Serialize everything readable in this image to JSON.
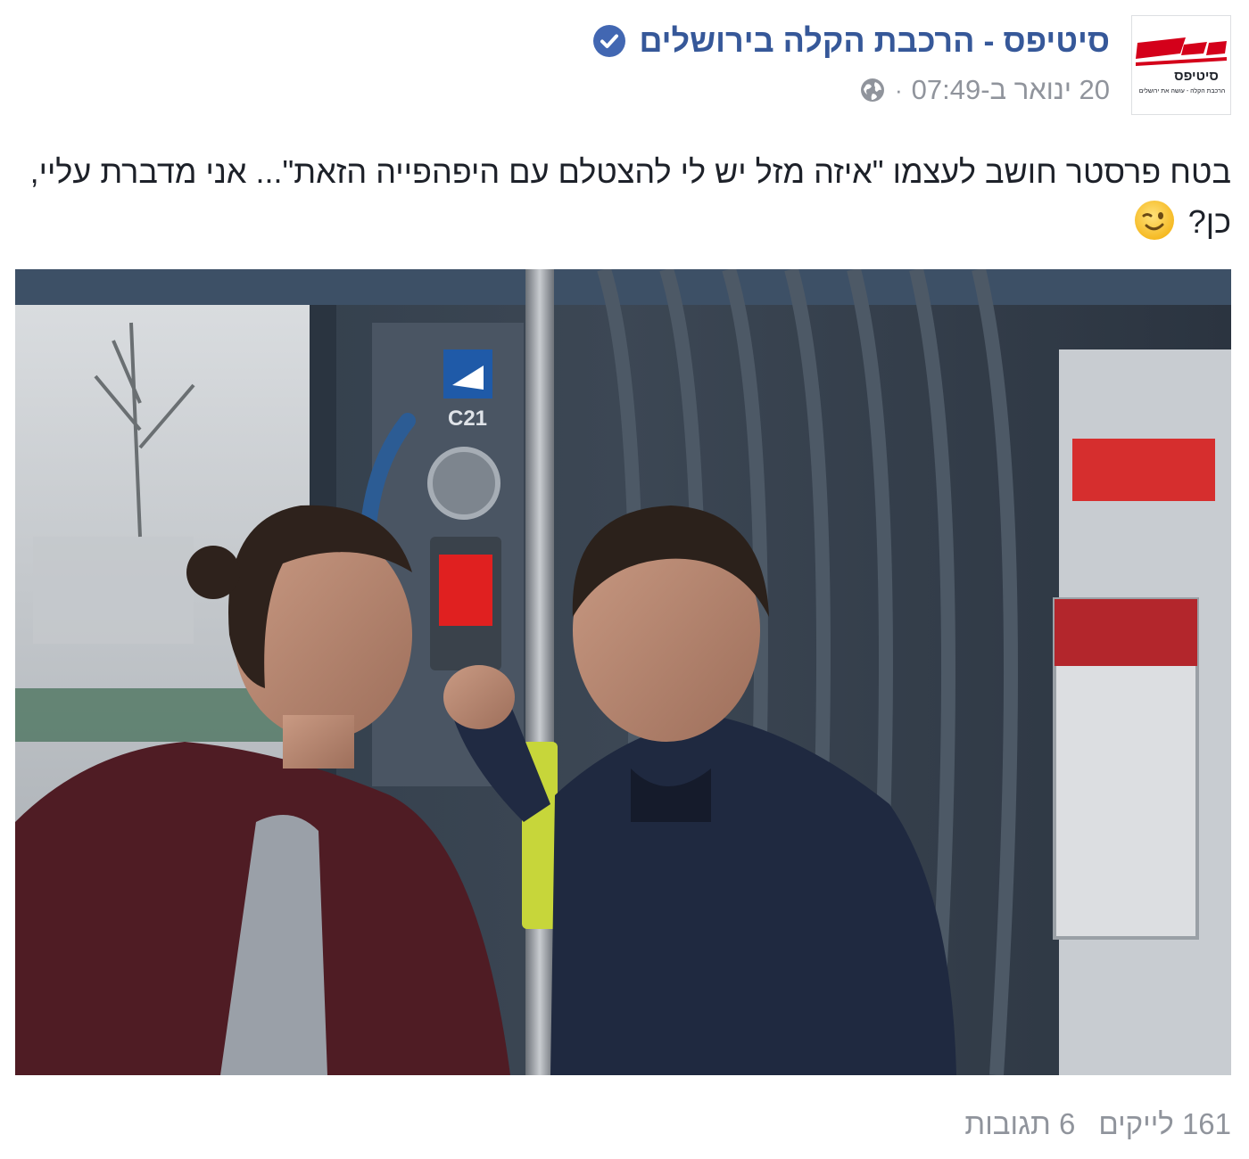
{
  "page": {
    "name": "סיטיפס - הרכבת הקלה בירושלים",
    "timestamp": "20 ינואר ב-07:49",
    "separator": "·",
    "avatar_text": "סיטיפס",
    "avatar_subtext": "הרכבת הקלה - עושה את ירושלים",
    "icons": {
      "verified": "verified-check-icon",
      "audience": "globe-icon"
    }
  },
  "post": {
    "text": "בטח פרסטר חושב לעצמו \"איזה מזל יש לי להצטלם עם היפהפייה הזאת\"... אני מדברת עליי, כן?",
    "emoji": "wink-emoji"
  },
  "photo": {
    "door_sign": "C21"
  },
  "footer": {
    "likes": "161 לייקים",
    "comments": "6 תגובות"
  },
  "colors": {
    "brand_link": "#365899",
    "meta_gray": "#90949c",
    "verified_blue": "#4267b2",
    "cityPass_red": "#d4001a"
  }
}
